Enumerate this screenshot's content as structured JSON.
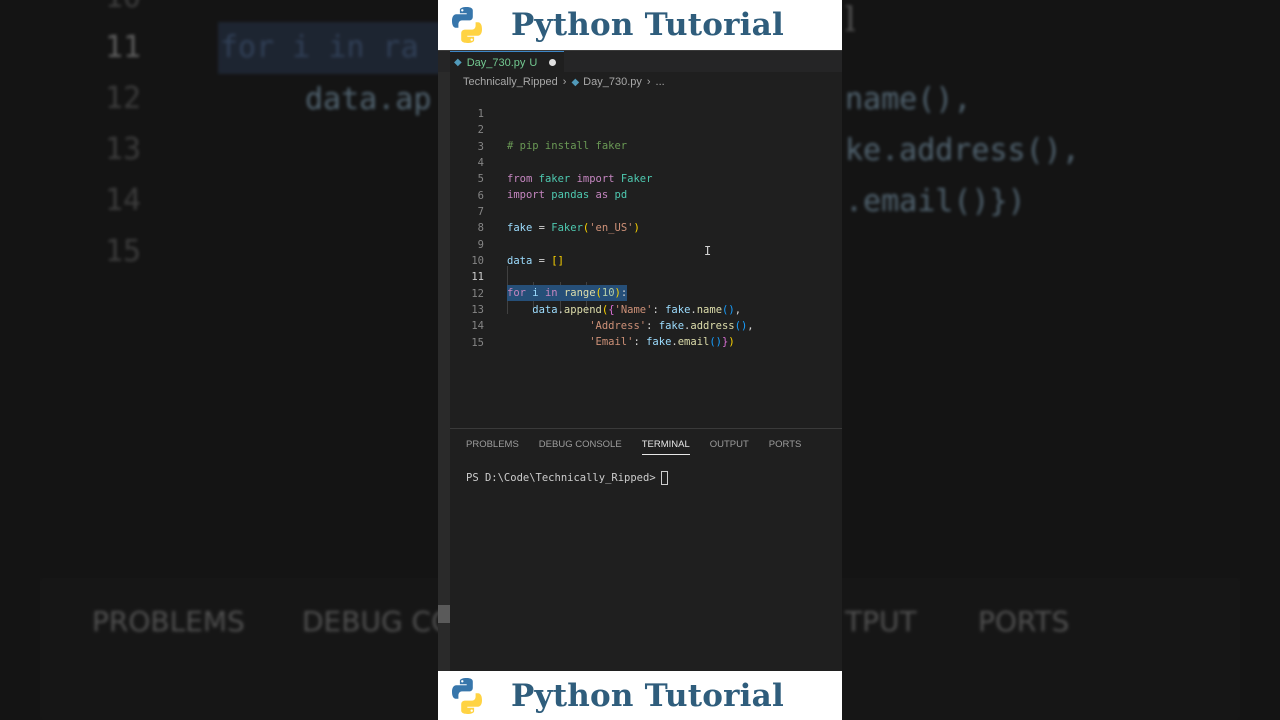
{
  "banner": {
    "title": "Python Tutorial"
  },
  "editor": {
    "tab": {
      "filename": "Day_730.py",
      "status": "U"
    },
    "breadcrumb": {
      "folder": "Technically_Ripped",
      "file": "Day_730.py",
      "more": "..."
    },
    "line_numbers": [
      "1",
      "2",
      "3",
      "4",
      "5",
      "6",
      "7",
      "8",
      "9",
      "10",
      "11",
      "12",
      "13",
      "14",
      "15"
    ],
    "cursor_icon": "i-beam-cursor-icon"
  },
  "panel": {
    "tabs": [
      "PROBLEMS",
      "DEBUG CONSOLE",
      "TERMINAL",
      "OUTPUT",
      "PORTS"
    ],
    "active_tab": "TERMINAL",
    "prompt": "PS D:\\Code\\Technically_Ripped>"
  },
  "colors": {
    "banner_text": "#2f5d7c",
    "editor_bg": "#1f1f1f",
    "selection": "#264f78",
    "keyword": "#c586c0",
    "string": "#ce9178",
    "comment": "#6a9955"
  }
}
